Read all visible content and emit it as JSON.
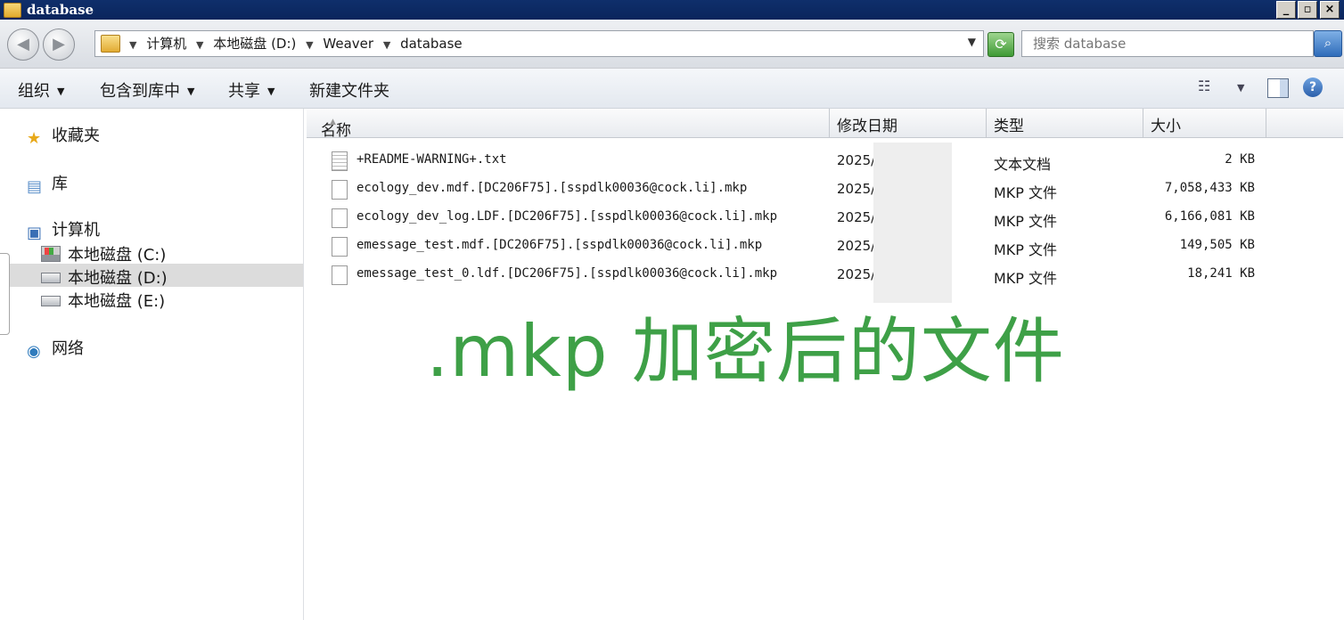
{
  "window": {
    "title": "database",
    "minimize": "_",
    "restore": "▫",
    "close": "×"
  },
  "address": {
    "crumbs": [
      "计算机",
      "本地磁盘 (D:)",
      "Weaver",
      "database"
    ],
    "search_placeholder": "搜索 database"
  },
  "toolbar": {
    "organize": "组织",
    "include_in_library": "包含到库中",
    "share": "共享",
    "new_folder": "新建文件夹"
  },
  "nav": {
    "favorites": "收藏夹",
    "libraries": "库",
    "computer": "计算机",
    "drive_c": "本地磁盘 (C:)",
    "drive_d": "本地磁盘 (D:)",
    "drive_e": "本地磁盘 (E:)",
    "network": "网络"
  },
  "columns": {
    "name": "名称",
    "modified": "修改日期",
    "type": "类型",
    "size": "大小"
  },
  "files": [
    {
      "name": "+README-WARNING+.txt",
      "date": "2025/",
      "type": "文本文档",
      "size": "2 KB"
    },
    {
      "name": "ecology_dev.mdf.[DC206F75].[sspdlk00036@cock.li].mkp",
      "date": "2025/",
      "type": "MKP 文件",
      "size": "7,058,433 KB"
    },
    {
      "name": "ecology_dev_log.LDF.[DC206F75].[sspdlk00036@cock.li].mkp",
      "date": "2025/",
      "type": "MKP 文件",
      "size": "6,166,081 KB"
    },
    {
      "name": "emessage_test.mdf.[DC206F75].[sspdlk00036@cock.li].mkp",
      "date": "2025/",
      "type": "MKP 文件",
      "size": "149,505 KB"
    },
    {
      "name": "emessage_test_0.ldf.[DC206F75].[sspdlk00036@cock.li].mkp",
      "date": "2025/",
      "type": "MKP 文件",
      "size": "18,241 KB"
    }
  ],
  "overlay_caption": ".mkp 加密后的文件"
}
